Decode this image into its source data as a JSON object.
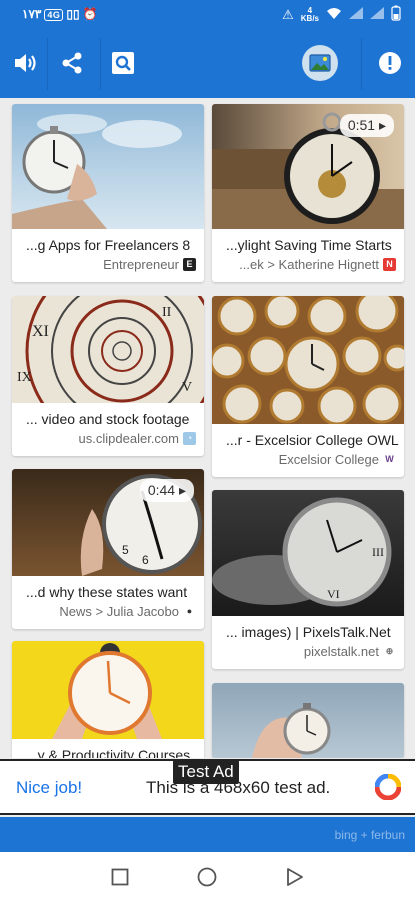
{
  "statusbar": {
    "left_text": "١٧٣",
    "left_badge": "4G",
    "speed": "4\nKB/s"
  },
  "toolbar": {
    "speaker_icon": "speaker-icon",
    "share_icon": "share-icon",
    "search_icon": "search-icon",
    "image_icon": "image-icon",
    "info_icon": "info-icon"
  },
  "results": [
    {
      "caption": "...g Apps for Freelancers 8",
      "source": "Entrepreneur",
      "favicon": "E",
      "favicon_color": "#222222",
      "video": ""
    },
    {
      "caption": "...ylight Saving Time Starts",
      "source": "...ek > Katherine Hignett",
      "favicon": "N",
      "favicon_color": "#e53935",
      "video": "0:51"
    },
    {
      "caption": "... video and stock footage",
      "source": "us.clipdealer.com",
      "favicon": "◔",
      "favicon_color": "#9ec8e8",
      "video": ""
    },
    {
      "caption": "...r - Excelsior College OWL",
      "source": "Excelsior College",
      "favicon": "W",
      "favicon_color": "#6a3d8a",
      "video": ""
    },
    {
      "caption": "...d why these states want",
      "source": "News > Julia Jacobo",
      "favicon": "●",
      "favicon_color": "#333333",
      "video": "0:44"
    },
    {
      "caption": "... images) | PixelsTalk.Net",
      "source": "pixelstalk.net",
      "favicon": "⊕",
      "favicon_color": "#777777",
      "video": ""
    },
    {
      "caption": "...y & Productivity Courses",
      "source": "",
      "favicon": "",
      "favicon_color": "#ffffff",
      "video": ""
    },
    {
      "caption": "",
      "source": "",
      "favicon": "",
      "favicon_color": "#ffffff",
      "video": ""
    }
  ],
  "ad": {
    "nice": "Nice job!",
    "text": "This is a 468x60 test ad.",
    "tag": "Test Ad"
  },
  "footer": {
    "credit": "bing + ferbun"
  },
  "colors": {
    "primary": "#1e74d2",
    "ad_link": "#1a73e8"
  }
}
